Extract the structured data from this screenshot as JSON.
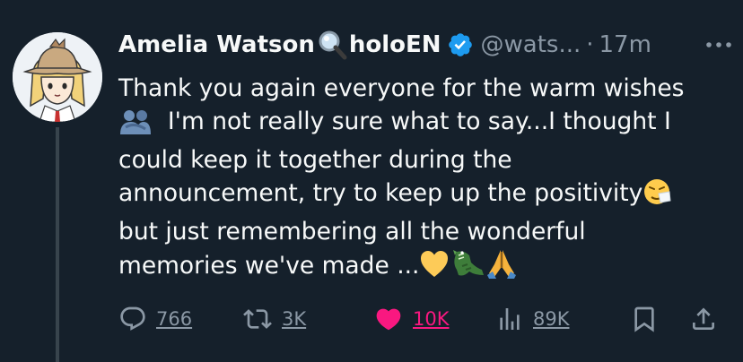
{
  "author": {
    "name": "Amelia Watson",
    "affiliation": "holoEN",
    "handle": "@wats...",
    "time": "17m"
  },
  "tweet": {
    "lines": [
      "Thank you again everyone for the warm wishes",
      "I'm not really sure what to say...I thought I",
      "could keep it together during the",
      "announcement, try to keep up the positivity",
      "but just remembering all the wonderful",
      "memories we've made ..."
    ],
    "emojis": [
      "people-hugging",
      "sneezing-face",
      "yellow-heart",
      "crocodile",
      "folded-hands"
    ]
  },
  "actions": {
    "replies": "766",
    "reposts": "3K",
    "likes": "10K",
    "views": "89K",
    "liked": true
  },
  "colors": {
    "background": "#15202b",
    "text": "#f7f9f9",
    "muted": "#8b98a5",
    "like": "#f91880",
    "verified": "#1d9bf0"
  },
  "icons": [
    "magnifying-glass-icon",
    "verified-badge-icon",
    "more-icon",
    "reply-icon",
    "repost-icon",
    "heart-icon",
    "views-icon",
    "bookmark-icon",
    "share-icon"
  ]
}
